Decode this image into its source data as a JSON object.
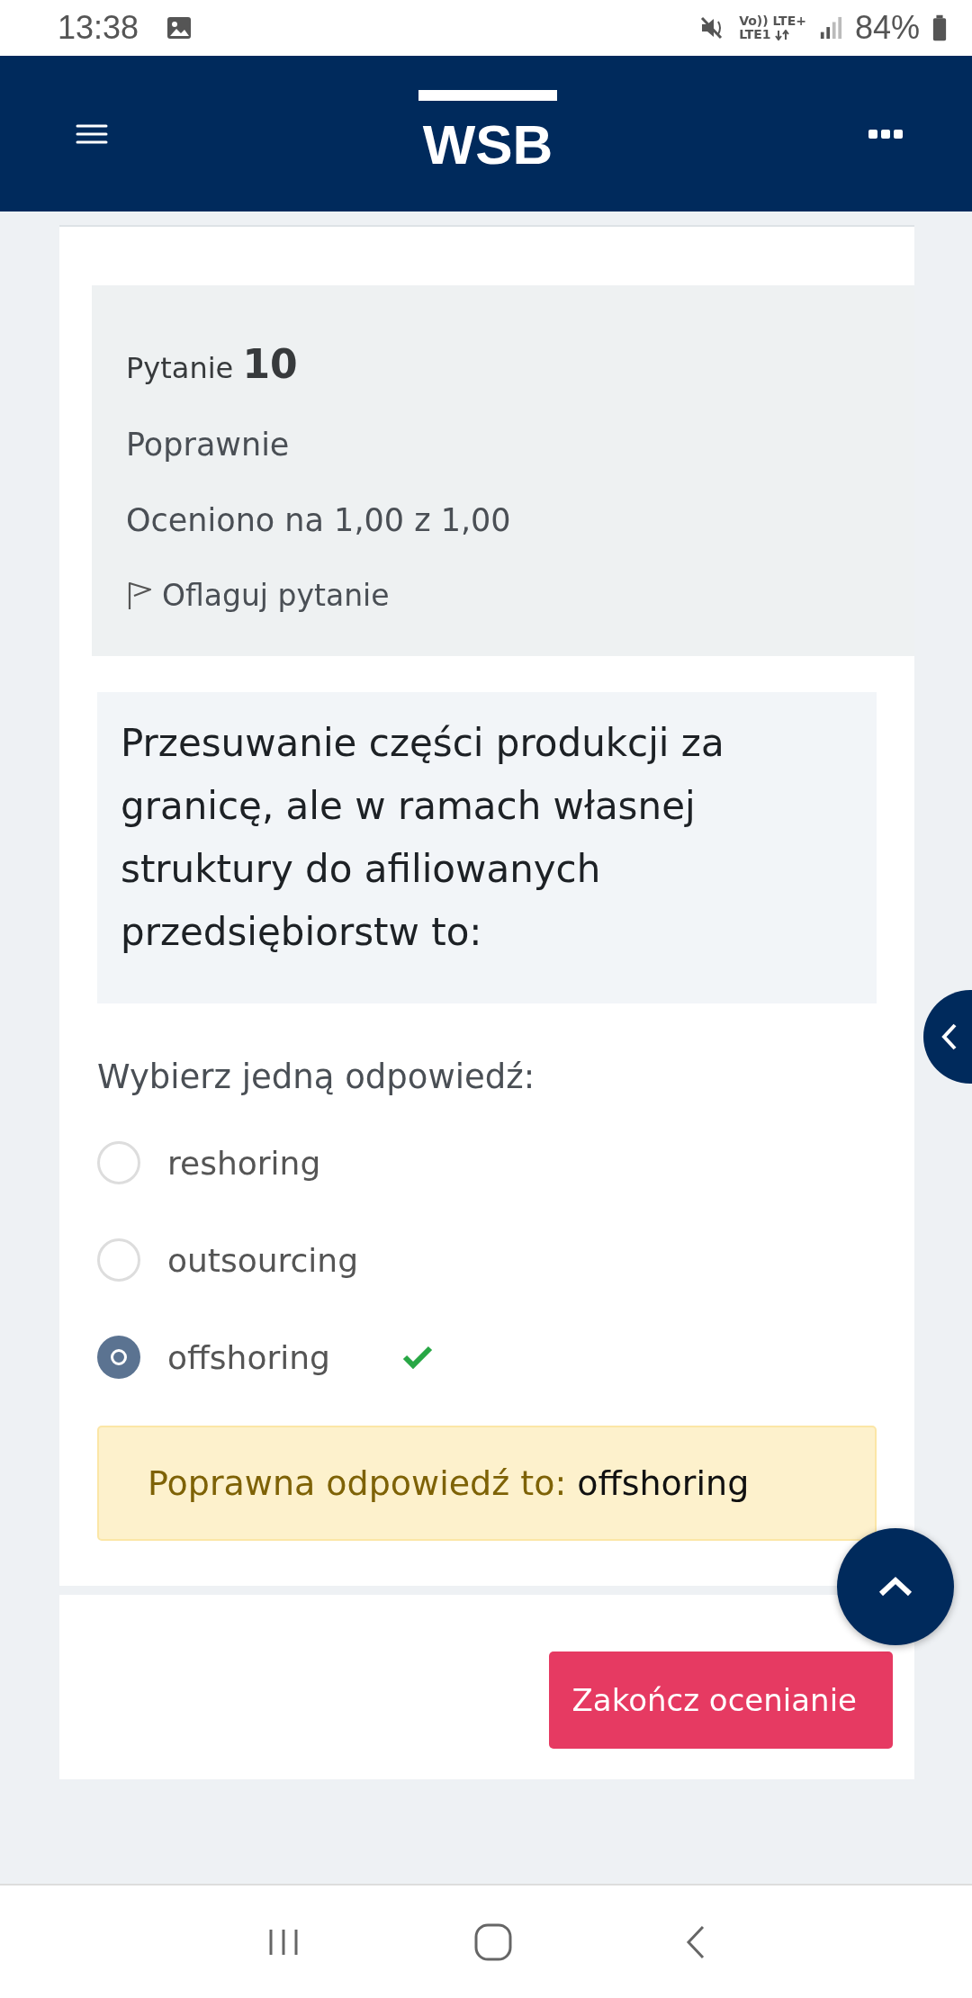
{
  "status_bar": {
    "time": "13:38",
    "network_top": "Vo)) LTE+",
    "network_bottom": "LTE1",
    "battery": "84%"
  },
  "header": {
    "logo": "WSB"
  },
  "question": {
    "label": "Pytanie",
    "number": "10",
    "state": "Poprawnie",
    "grade": "Oceniono na 1,00 z 1,00",
    "flag": {
      "label": "Oflaguj pytanie",
      "flagged": false
    },
    "text": "Przesuwanie części produkcji za granicę, ale w ramach własnej struktury do afiliowanych przedsiębiorstw to:",
    "prompt": "Wybierz jedną odpowiedź:",
    "options": [
      {
        "label": "reshoring",
        "selected": false,
        "correct": false
      },
      {
        "label": "outsourcing",
        "selected": false,
        "correct": false
      },
      {
        "label": "offshoring",
        "selected": true,
        "correct": true
      }
    ],
    "feedback": {
      "label": "Poprawna odpowiedź to:",
      "answer": "offshoring"
    }
  },
  "finish_button": "Zakończ ocenianie"
}
